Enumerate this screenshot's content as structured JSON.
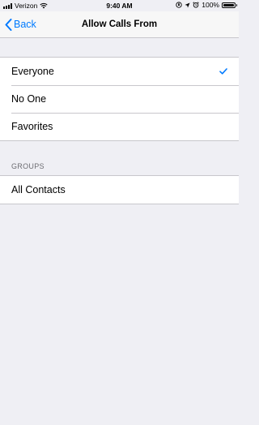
{
  "status": {
    "carrier": "Verizon",
    "time": "9:40 AM",
    "battery": "100%",
    "battery_level": 1.0
  },
  "nav": {
    "back_label": "Back",
    "title": "Allow Calls From"
  },
  "options": [
    {
      "label": "Everyone",
      "selected": true
    },
    {
      "label": "No One",
      "selected": false
    },
    {
      "label": "Favorites",
      "selected": false
    }
  ],
  "groups": {
    "header": "GROUPS",
    "items": [
      {
        "label": "All Contacts"
      }
    ]
  },
  "colors": {
    "accent": "#007aff",
    "background": "#efeff4"
  },
  "icons": [
    "signal-icon",
    "wifi-icon",
    "location-icon",
    "alarm-icon",
    "orientation-lock-icon",
    "battery-icon",
    "chevron-left-icon",
    "checkmark-icon"
  ]
}
